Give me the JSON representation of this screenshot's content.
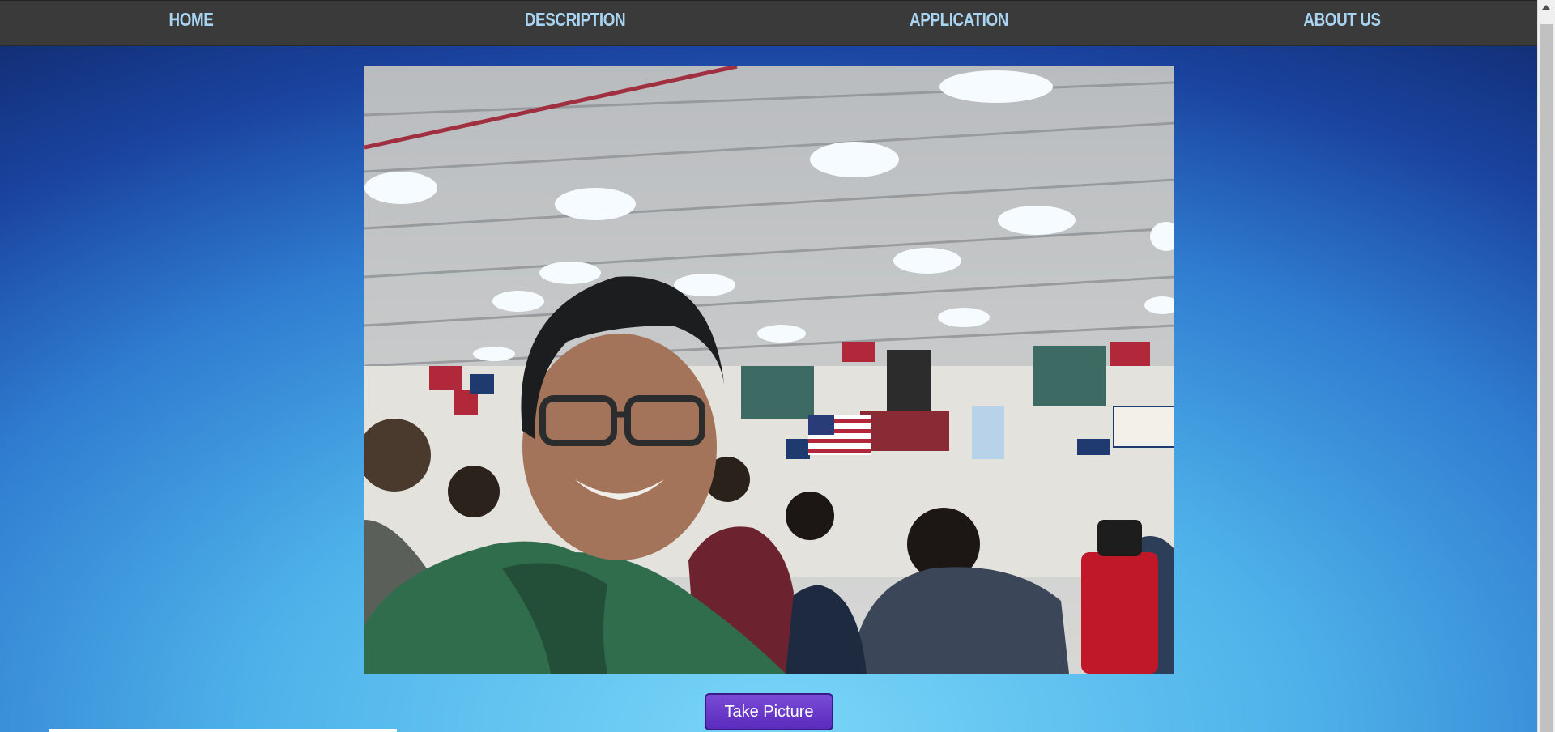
{
  "nav": {
    "items": [
      {
        "label": "HOME"
      },
      {
        "label": "DESCRIPTION"
      },
      {
        "label": "APPLICATION"
      },
      {
        "label": "ABOUT US"
      }
    ]
  },
  "camera": {
    "button_label": "Take Picture"
  },
  "colors": {
    "nav_bg": "#3a3a3a",
    "nav_text": "#a8d4f2",
    "button_bg": "#5a2bbd"
  }
}
